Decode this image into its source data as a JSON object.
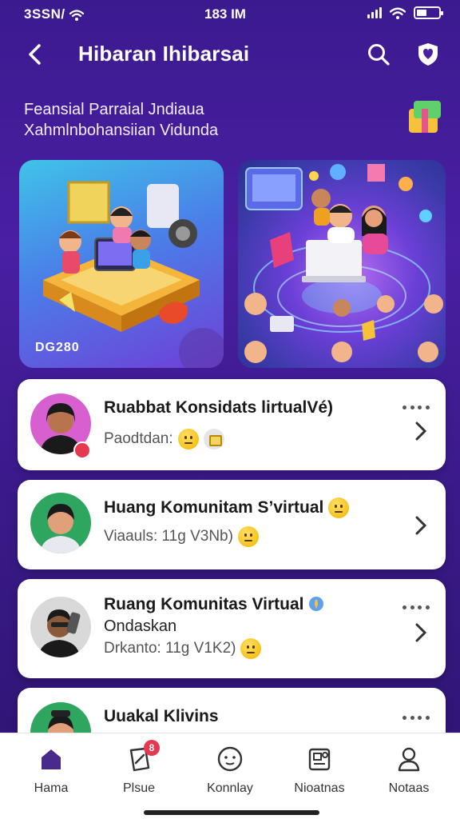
{
  "status_bar": {
    "carrier": "3SSN/",
    "time": "183 IM"
  },
  "header": {
    "title": "Hibaran Ihibarsai"
  },
  "subtitle": {
    "line1": "Feansial Parraial Jndiaua",
    "line2": "Xahmlnbohansiian Vidunda"
  },
  "banner": {
    "code": "DG280"
  },
  "cards": [
    {
      "title": "Ruabbat Konsidats lirtualVé)",
      "subtitle": "Paodtdan:",
      "avatar_color": "#d85fd0"
    },
    {
      "title": "Huang Komunitam S’virtual",
      "subtitle": "Viaauls: 11g V3Nb)",
      "avatar_color": "#2fa660"
    },
    {
      "title": "Ruang Komunitas Virtual",
      "line2": "Ondaskan",
      "subtitle": "Drkanto: 11g V1K2)",
      "avatar_color": "#d9d9d9"
    },
    {
      "title": "Uuakal Klivins",
      "avatar_color": "#2fa660"
    }
  ],
  "bottom_nav": [
    {
      "label": "Hama",
      "icon": "home-icon",
      "active": true
    },
    {
      "label": "Plsue",
      "icon": "edit-doc-icon",
      "badge": "8"
    },
    {
      "label": "Konnlay",
      "icon": "face-icon"
    },
    {
      "label": "Nioatnas",
      "icon": "news-icon"
    },
    {
      "label": "Notaas",
      "icon": "person-icon"
    }
  ],
  "colors": {
    "background_top": "#3b1a8f",
    "background_bottom": "#2d1470",
    "accent": "#5b2fb8",
    "badge": "#e53950"
  }
}
